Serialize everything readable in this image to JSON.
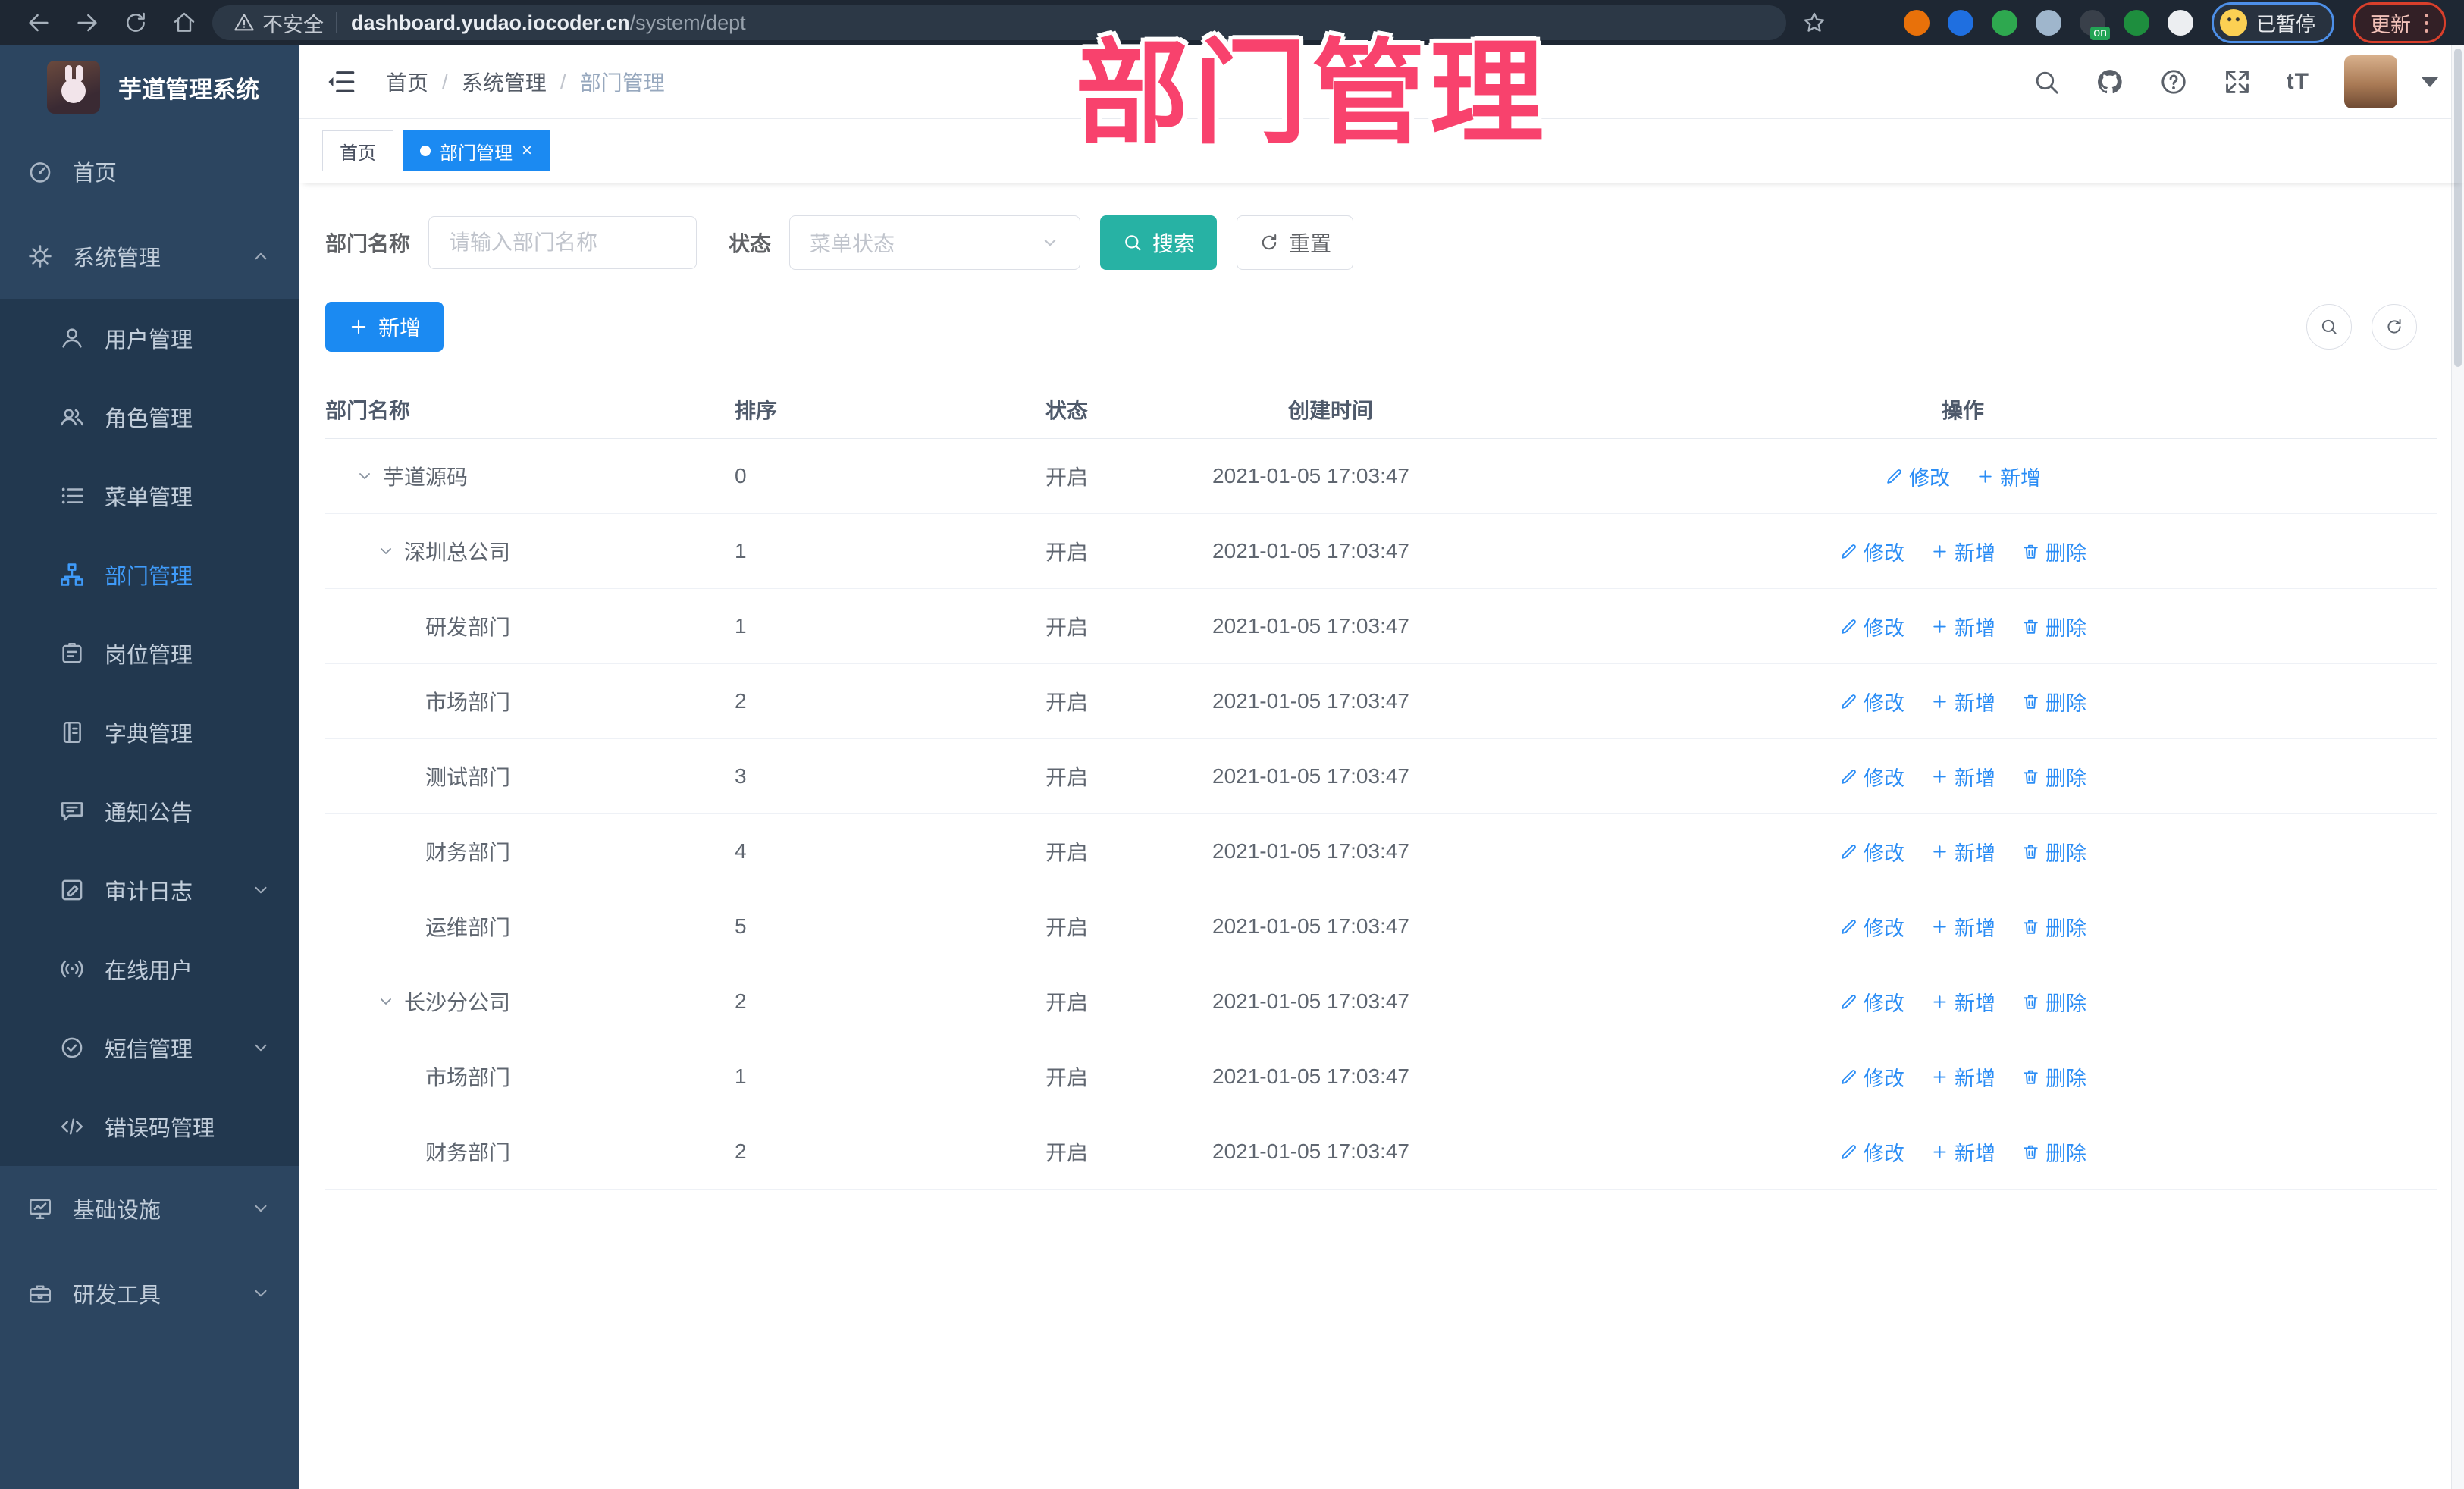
{
  "browser": {
    "security_label": "不安全",
    "url_host": "dashboard.yudao.iocoder.cn",
    "url_path": "/system/dept",
    "profile_status": "已暂停",
    "update_label": "更新",
    "extensions": [
      {
        "name": "extension-orange-ring",
        "color": "#e8710a"
      },
      {
        "name": "extension-blue-gem",
        "color": "#1f6fe0"
      },
      {
        "name": "extension-green-check",
        "color": "#2ea84f"
      },
      {
        "name": "extension-grid-drop",
        "color": "#9fb6cc"
      },
      {
        "name": "extension-dark-recorder",
        "color": "#39404a",
        "badge": "on"
      },
      {
        "name": "extension-green-key",
        "color": "#1e8e3e"
      },
      {
        "name": "extension-puzzle",
        "color": "#eceef1"
      }
    ]
  },
  "annotation": {
    "title": "部门管理",
    "color": "#f8426d"
  },
  "sidebar": {
    "app_title": "芋道管理系统",
    "items": [
      {
        "label": "首页",
        "icon": "dashboard-icon",
        "is_top": true,
        "is_sub": false,
        "active": false,
        "chevron_up": false,
        "chevron_down": false
      },
      {
        "label": "系统管理",
        "icon": "gear-icon",
        "is_top": true,
        "is_sub": false,
        "active": false,
        "chevron_up": true,
        "chevron_down": false
      },
      {
        "label": "用户管理",
        "icon": "user-icon",
        "is_top": false,
        "is_sub": true,
        "active": false,
        "chevron_up": false,
        "chevron_down": false
      },
      {
        "label": "角色管理",
        "icon": "users-icon",
        "is_top": false,
        "is_sub": true,
        "active": false,
        "chevron_up": false,
        "chevron_down": false
      },
      {
        "label": "菜单管理",
        "icon": "menu-list-icon",
        "is_top": false,
        "is_sub": true,
        "active": false,
        "chevron_up": false,
        "chevron_down": false
      },
      {
        "label": "部门管理",
        "icon": "org-tree-icon",
        "is_top": false,
        "is_sub": true,
        "active": true,
        "chevron_up": false,
        "chevron_down": false
      },
      {
        "label": "岗位管理",
        "icon": "id-badge-icon",
        "is_top": false,
        "is_sub": true,
        "active": false,
        "chevron_up": false,
        "chevron_down": false
      },
      {
        "label": "字典管理",
        "icon": "dictionary-icon",
        "is_top": false,
        "is_sub": true,
        "active": false,
        "chevron_up": false,
        "chevron_down": false
      },
      {
        "label": "通知公告",
        "icon": "notice-bubble-icon",
        "is_top": false,
        "is_sub": true,
        "active": false,
        "chevron_up": false,
        "chevron_down": false
      },
      {
        "label": "审计日志",
        "icon": "audit-log-icon",
        "is_top": false,
        "is_sub": true,
        "active": false,
        "chevron_up": false,
        "chevron_down": true
      },
      {
        "label": "在线用户",
        "icon": "online-users-icon",
        "is_top": false,
        "is_sub": true,
        "active": false,
        "chevron_up": false,
        "chevron_down": false
      },
      {
        "label": "短信管理",
        "icon": "sms-check-icon",
        "is_top": false,
        "is_sub": true,
        "active": false,
        "chevron_up": false,
        "chevron_down": true
      },
      {
        "label": "错误码管理",
        "icon": "code-icon",
        "is_top": false,
        "is_sub": true,
        "active": false,
        "chevron_up": false,
        "chevron_down": false
      },
      {
        "label": "基础设施",
        "icon": "monitor-icon",
        "is_top": true,
        "is_sub": false,
        "active": false,
        "chevron_up": false,
        "chevron_down": true
      },
      {
        "label": "研发工具",
        "icon": "toolbox-icon",
        "is_top": true,
        "is_sub": false,
        "active": false,
        "chevron_up": false,
        "chevron_down": true
      }
    ]
  },
  "header": {
    "breadcrumb": [
      "首页",
      "系统管理",
      "部门管理"
    ]
  },
  "tabs": [
    {
      "label": "首页",
      "active": false,
      "closable": false
    },
    {
      "label": "部门管理",
      "active": true,
      "closable": true
    }
  ],
  "filters": {
    "dept_name_label": "部门名称",
    "dept_name_placeholder": "请输入部门名称",
    "status_label": "状态",
    "status_placeholder": "菜单状态",
    "search_label": "搜索",
    "reset_label": "重置"
  },
  "toolbar": {
    "add_label": "新增"
  },
  "table": {
    "columns": {
      "name": "部门名称",
      "sort": "排序",
      "status": "状态",
      "created": "创建时间",
      "actions": "操作"
    },
    "rows": [
      {
        "name": "芋道源码",
        "level": 0,
        "expandable": true,
        "sort": "0",
        "status": "开启",
        "created": "2021-01-05 17:03:47",
        "actions": {
          "0": "修改",
          "1": "新增"
        }
      },
      {
        "name": "深圳总公司",
        "level": 1,
        "expandable": true,
        "sort": "1",
        "status": "开启",
        "created": "2021-01-05 17:03:47",
        "actions": {
          "0": "修改",
          "1": "新增",
          "2": "删除"
        }
      },
      {
        "name": "研发部门",
        "level": 2,
        "expandable": false,
        "sort": "1",
        "status": "开启",
        "created": "2021-01-05 17:03:47",
        "actions": {
          "0": "修改",
          "1": "新增",
          "2": "删除"
        }
      },
      {
        "name": "市场部门",
        "level": 2,
        "expandable": false,
        "sort": "2",
        "status": "开启",
        "created": "2021-01-05 17:03:47",
        "actions": {
          "0": "修改",
          "1": "新增",
          "2": "删除"
        }
      },
      {
        "name": "测试部门",
        "level": 2,
        "expandable": false,
        "sort": "3",
        "status": "开启",
        "created": "2021-01-05 17:03:47",
        "actions": {
          "0": "修改",
          "1": "新增",
          "2": "删除"
        }
      },
      {
        "name": "财务部门",
        "level": 2,
        "expandable": false,
        "sort": "4",
        "status": "开启",
        "created": "2021-01-05 17:03:47",
        "actions": {
          "0": "修改",
          "1": "新增",
          "2": "删除"
        }
      },
      {
        "name": "运维部门",
        "level": 2,
        "expandable": false,
        "sort": "5",
        "status": "开启",
        "created": "2021-01-05 17:03:47",
        "actions": {
          "0": "修改",
          "1": "新增",
          "2": "删除"
        }
      },
      {
        "name": "长沙分公司",
        "level": 1,
        "expandable": true,
        "sort": "2",
        "status": "开启",
        "created": "2021-01-05 17:03:47",
        "actions": {
          "0": "修改",
          "1": "新增",
          "2": "删除"
        }
      },
      {
        "name": "市场部门",
        "level": 2,
        "expandable": false,
        "sort": "1",
        "status": "开启",
        "created": "2021-01-05 17:03:47",
        "actions": {
          "0": "修改",
          "1": "新增",
          "2": "删除"
        }
      },
      {
        "name": "财务部门",
        "level": 2,
        "expandable": false,
        "sort": "2",
        "status": "开启",
        "created": "2021-01-05 17:03:47",
        "actions": {
          "0": "修改",
          "1": "新增",
          "2": "删除"
        }
      }
    ]
  },
  "theme": {
    "accent_blue": "#1b8af2",
    "link_blue": "#2b8df5",
    "teal": "#27b2a4",
    "sidebar_bg": "#2c4560",
    "sidebar_sub_bg": "#22384f",
    "annotation_pink": "#f8426d"
  }
}
